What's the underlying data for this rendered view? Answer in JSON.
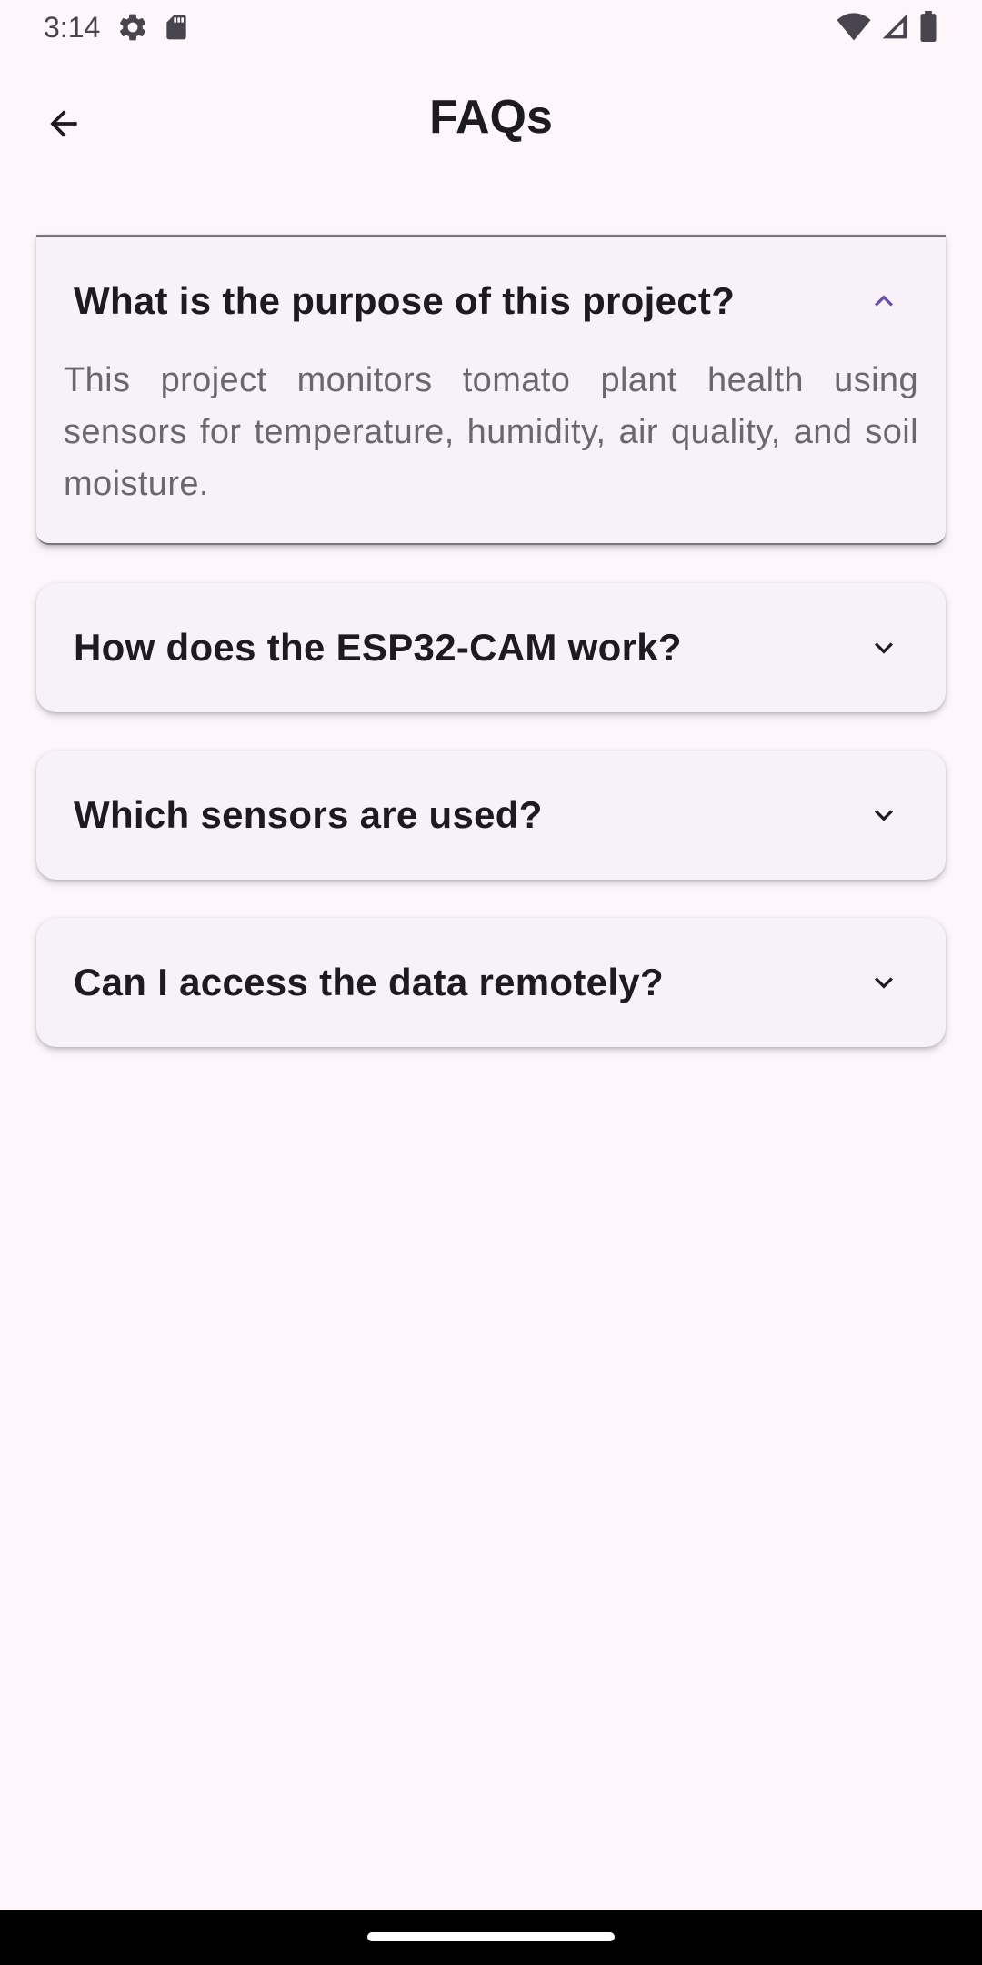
{
  "status_bar": {
    "time": "3:14",
    "left_icons": [
      "settings-gear-icon",
      "sd-card-icon"
    ],
    "right_icons": [
      "wifi-icon",
      "cell-signal-icon",
      "battery-icon"
    ]
  },
  "app_bar": {
    "title": "FAQs",
    "back_icon": "arrow-back-icon"
  },
  "faqs": [
    {
      "question": "What is the purpose of this project?",
      "answer": "This project monitors tomato plant health using sensors for temperature, humidity, air quality, and soil moisture.",
      "expanded": true
    },
    {
      "question": "How does the ESP32-CAM work?",
      "expanded": false
    },
    {
      "question": "Which sensors are used?",
      "expanded": false
    },
    {
      "question": "Can I access the data remotely?",
      "expanded": false
    }
  ],
  "colors": {
    "background": "#fdf7fb",
    "card": "#f7f2fa",
    "accent": "#6750a4",
    "text": "#1d1b20",
    "answer_text": "#6b6670"
  }
}
